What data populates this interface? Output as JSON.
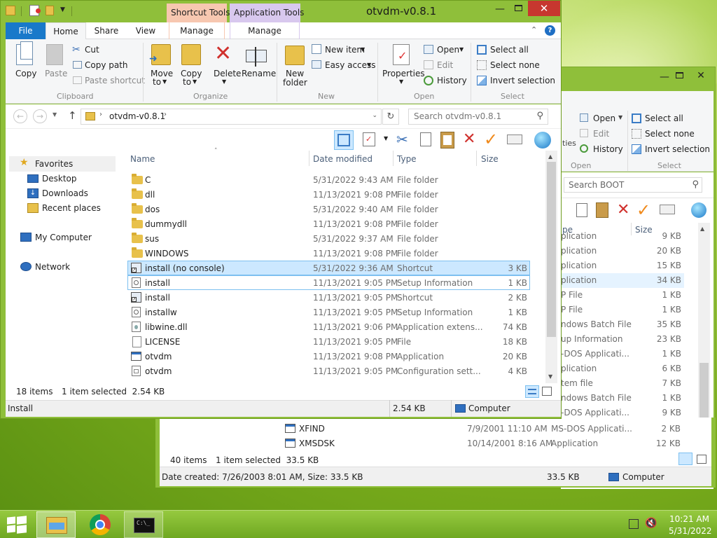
{
  "desktop": {
    "leaf": "wallpaper"
  },
  "back_window": {
    "ribbon": {
      "open": "Open",
      "edit": "Edit",
      "history": "History",
      "open_group": "Open",
      "select_all": "Select all",
      "select_none": "Select none",
      "invert_selection": "Invert selection",
      "select_group": "Select",
      "properties_partial": "ties"
    },
    "search_placeholder": "Search BOOT",
    "size_header": "Size",
    "type_header_partial": "pe",
    "rows": [
      {
        "type": "plication",
        "size": "9 KB"
      },
      {
        "type": "plication",
        "size": "20 KB"
      },
      {
        "type": "plication",
        "size": "15 KB"
      },
      {
        "type": "plication",
        "size": "34 KB"
      },
      {
        "type": "P File",
        "size": "1 KB"
      },
      {
        "type": "P File",
        "size": "1 KB"
      },
      {
        "type": "ndows Batch File",
        "size": "35 KB"
      },
      {
        "type": "up Information",
        "size": "23 KB"
      },
      {
        "type": "-DOS Applicati...",
        "size": "1 KB"
      },
      {
        "type": "plication",
        "size": "6 KB"
      },
      {
        "type": "tem file",
        "size": "7 KB"
      },
      {
        "type": "ndows Batch File",
        "size": "1 KB"
      },
      {
        "type": "-DOS Applicati...",
        "size": "9 KB"
      },
      {
        "name": "XFIND",
        "date": "7/9/2001 11:10 AM",
        "type": "MS-DOS Applicati...",
        "size": "2 KB"
      },
      {
        "name": "XMSDSK",
        "date": "10/14/2001 8:16 AM",
        "type": "Application",
        "size": "12 KB"
      }
    ],
    "status_items": "40 items",
    "status_selected": "1 item selected  33.5 KB",
    "details_text": "Date created: 7/26/2003 8:01 AM, Size: 33.5 KB",
    "details_size": "33.5 KB",
    "details_location": "Computer"
  },
  "front_window": {
    "title": "otvdm-v0.8.1",
    "context_tabs": {
      "shortcut_tools": "Shortcut Tools",
      "application_tools": "Application Tools",
      "manage1": "Manage",
      "manage2": "Manage"
    },
    "tabs": {
      "file": "File",
      "home": "Home",
      "share": "Share",
      "view": "View"
    },
    "ribbon": {
      "copy": "Copy",
      "paste": "Paste",
      "cut": "Cut",
      "copy_path": "Copy path",
      "paste_shortcut": "Paste shortcut",
      "clipboard": "Clipboard",
      "move_to": "Move",
      "move_to2": "to",
      "copy_to": "Copy",
      "copy_to2": "to",
      "delete": "Delete",
      "rename": "Rename",
      "organize": "Organize",
      "new_folder": "New",
      "new_folder2": "folder",
      "new_item": "New item",
      "easy_access": "Easy access",
      "new_group": "New",
      "properties": "Properties",
      "open": "Open",
      "edit": "Edit",
      "history": "History",
      "open_group": "Open",
      "select_all": "Select all",
      "select_none": "Select none",
      "invert_selection": "Invert selection",
      "select_group": "Select"
    },
    "address": "otvdm-v0.8.1",
    "search_placeholder": "Search otvdm-v0.8.1",
    "nav": {
      "favorites": "Favorites",
      "desktop": "Desktop",
      "downloads": "Downloads",
      "recent": "Recent places",
      "my_computer": "My Computer",
      "network": "Network"
    },
    "columns": {
      "name": "Name",
      "date": "Date modified",
      "type": "Type",
      "size": "Size"
    },
    "files": [
      {
        "name": "C",
        "date": "5/31/2022 9:43 AM",
        "type": "File folder",
        "size": "",
        "icon": "folder"
      },
      {
        "name": "dll",
        "date": "11/13/2021 9:08 PM",
        "type": "File folder",
        "size": "",
        "icon": "folder"
      },
      {
        "name": "dos",
        "date": "5/31/2022 9:40 AM",
        "type": "File folder",
        "size": "",
        "icon": "folder"
      },
      {
        "name": "dummydll",
        "date": "11/13/2021 9:08 PM",
        "type": "File folder",
        "size": "",
        "icon": "folder"
      },
      {
        "name": "sus",
        "date": "5/31/2022 9:37 AM",
        "type": "File folder",
        "size": "",
        "icon": "folder"
      },
      {
        "name": "WINDOWS",
        "date": "11/13/2021 9:08 PM",
        "type": "File folder",
        "size": "",
        "icon": "folder"
      },
      {
        "name": "install (no console)",
        "date": "5/31/2022 9:36 AM",
        "type": "Shortcut",
        "size": "3 KB",
        "icon": "shortcut"
      },
      {
        "name": "install",
        "date": "11/13/2021 9:05 PM",
        "type": "Setup Information",
        "size": "1 KB",
        "icon": "setup"
      },
      {
        "name": "install",
        "date": "11/13/2021 9:05 PM",
        "type": "Shortcut",
        "size": "2 KB",
        "icon": "shortcut"
      },
      {
        "name": "installw",
        "date": "11/13/2021 9:05 PM",
        "type": "Setup Information",
        "size": "1 KB",
        "icon": "setup"
      },
      {
        "name": "libwine.dll",
        "date": "11/13/2021 9:06 PM",
        "type": "Application extens...",
        "size": "74 KB",
        "icon": "dll"
      },
      {
        "name": "LICENSE",
        "date": "11/13/2021 9:05 PM",
        "type": "File",
        "size": "18 KB",
        "icon": "file"
      },
      {
        "name": "otvdm",
        "date": "11/13/2021 9:08 PM",
        "type": "Application",
        "size": "20 KB",
        "icon": "app"
      },
      {
        "name": "otvdm",
        "date": "11/13/2021 9:05 PM",
        "type": "Configuration sett...",
        "size": "4 KB",
        "icon": "config"
      }
    ],
    "status_items": "18 items",
    "status_selected": "1 item selected  2.54 KB",
    "details_text": "Install",
    "details_size": "2.54 KB",
    "details_location": "Computer"
  },
  "taskbar": {
    "time": "10:21 AM",
    "date": "5/31/2022"
  },
  "colors": {
    "frame": "#8fbf3a",
    "file_tab": "#1979ca",
    "close": "#c7372f",
    "selection": "#cce8ff",
    "shortcut_tab": "#f7c7b0",
    "app_tab": "#d8c8ee"
  }
}
